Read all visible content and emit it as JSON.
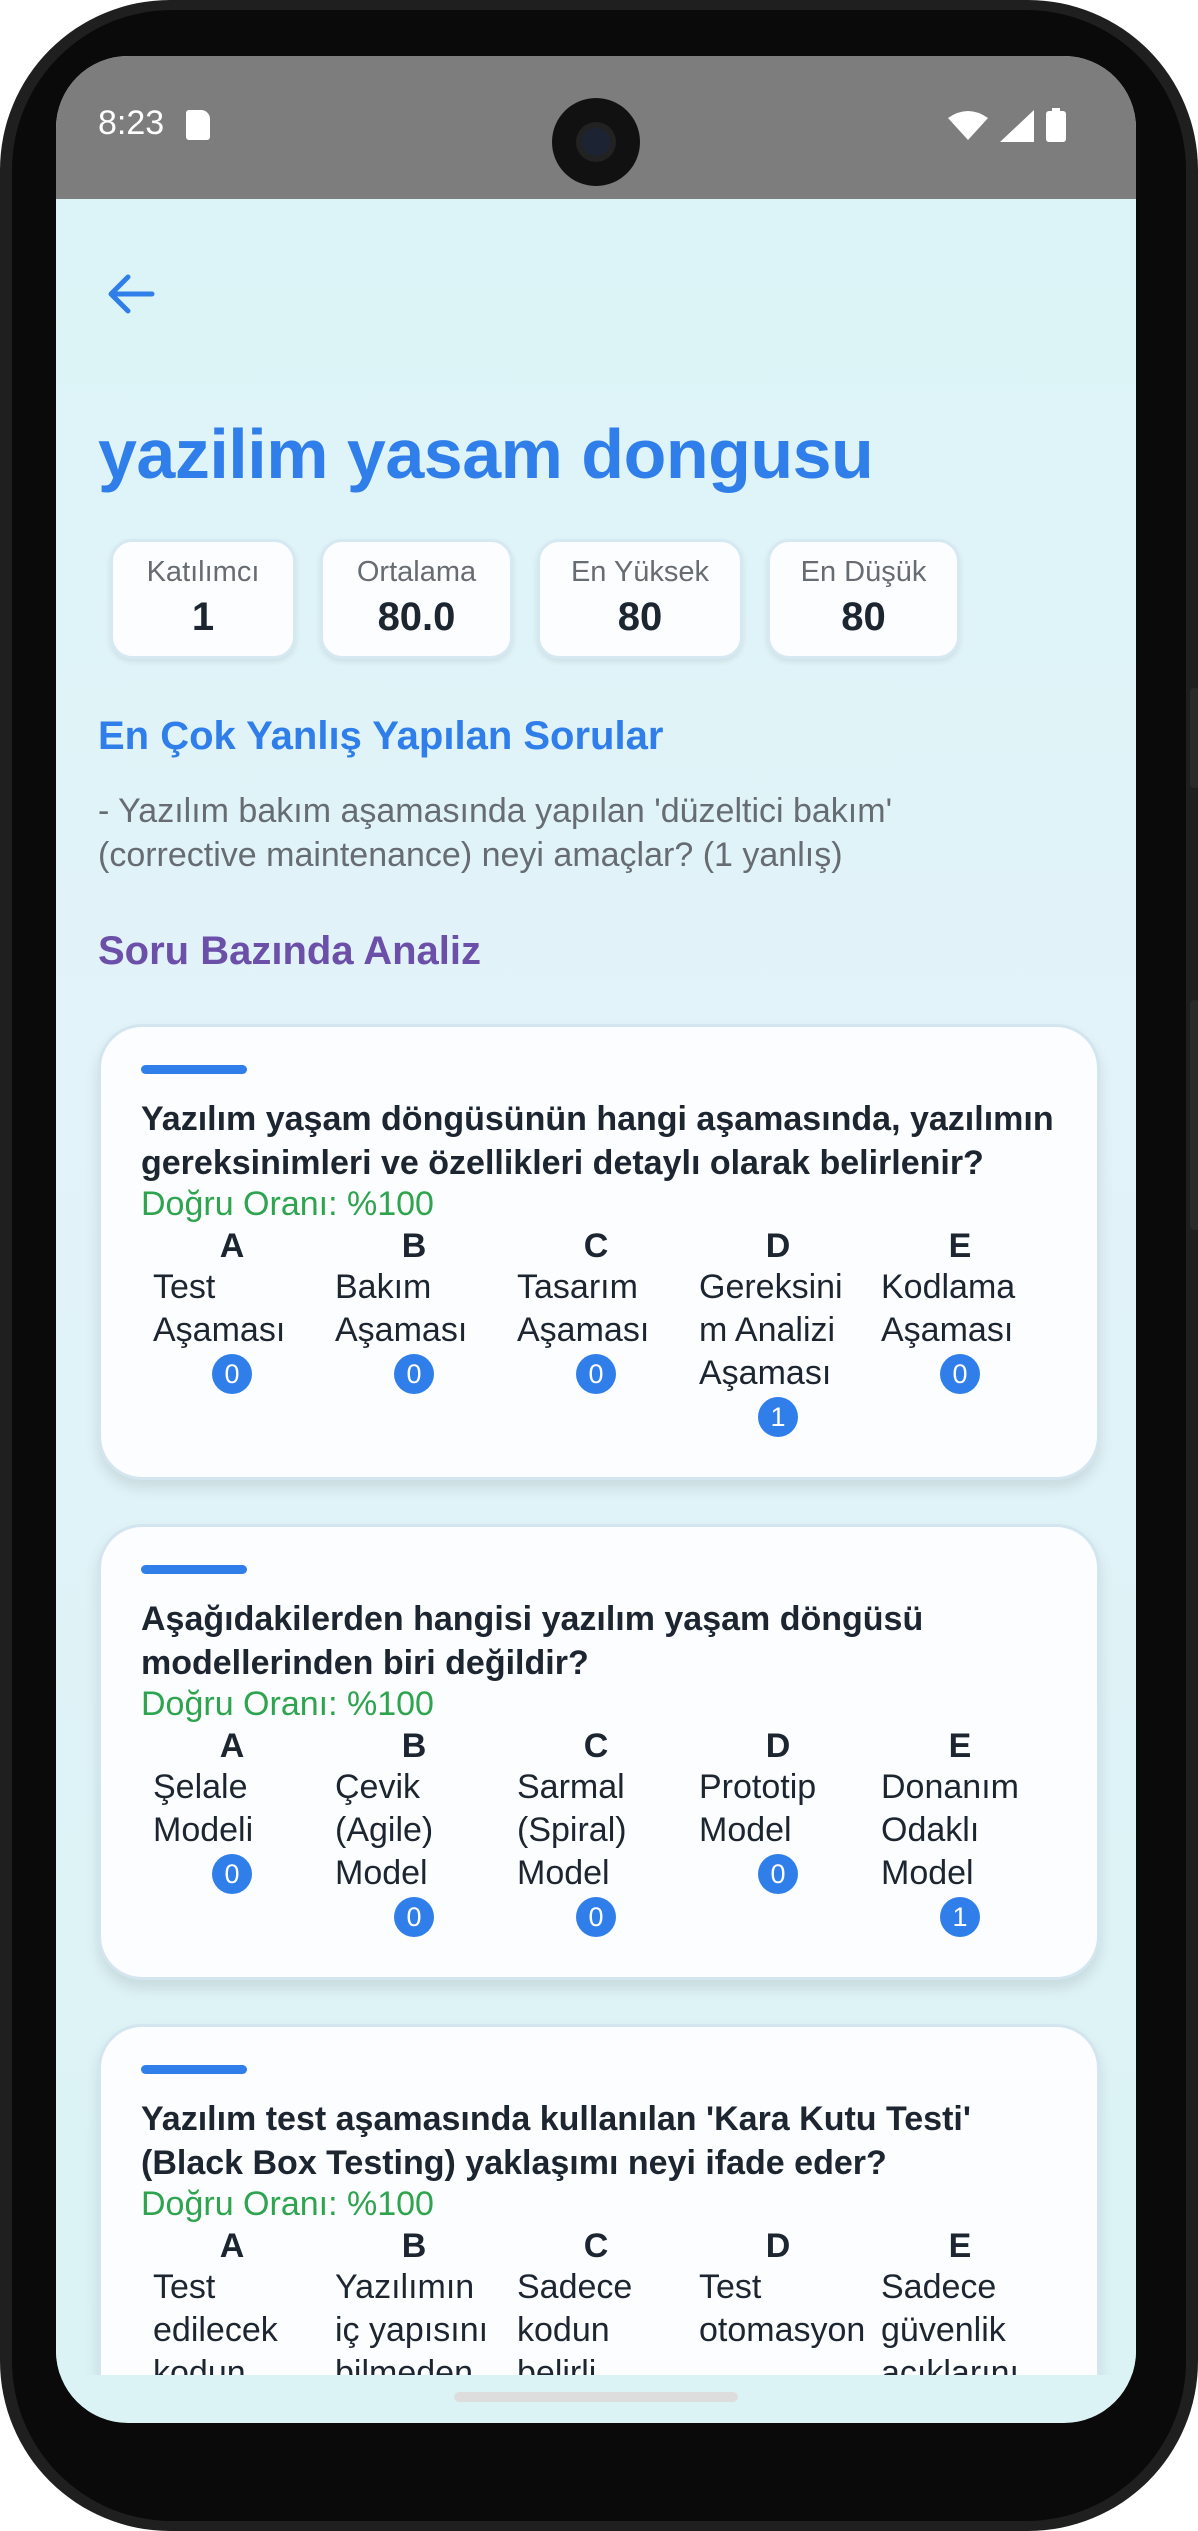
{
  "status_bar": {
    "time": "8:23"
  },
  "page": {
    "title": "yazilim yasam dongusu"
  },
  "stats": [
    {
      "label": "Katılımcı",
      "value": "1"
    },
    {
      "label": "Ortalama",
      "value": "80.0"
    },
    {
      "label": "En Yüksek",
      "value": "80"
    },
    {
      "label": "En Düşük",
      "value": "80"
    }
  ],
  "most_wrong": {
    "heading": "En Çok Yanlış Yapılan Sorular",
    "items": [
      "- Yazılım bakım aşamasında yapılan 'düzeltici bakım' (corrective maintenance) neyi amaçlar? (1 yanlış)"
    ]
  },
  "analysis": {
    "heading": "Soru Bazında Analiz",
    "questions": [
      {
        "text": "Yazılım yaşam döngüsünün hangi aşamasında, yazılımın gereksinimleri ve özellikleri detaylı olarak belirlenir?",
        "rate": "Doğru Oranı: %100",
        "options": [
          {
            "letter": "A",
            "text": "Test Aşaması",
            "count": "0"
          },
          {
            "letter": "B",
            "text": "Bakım Aşaması",
            "count": "0"
          },
          {
            "letter": "C",
            "text": "Tasarım Aşaması",
            "count": "0"
          },
          {
            "letter": "D",
            "text": "Gereksinim Analizi Aşaması",
            "count": "1"
          },
          {
            "letter": "E",
            "text": "Kodlama Aşaması",
            "count": "0"
          }
        ]
      },
      {
        "text": "Aşağıdakilerden hangisi yazılım yaşam döngüsü modellerinden biri değildir?",
        "rate": "Doğru Oranı: %100",
        "options": [
          {
            "letter": "A",
            "text": "Şelale Modeli",
            "count": "0"
          },
          {
            "letter": "B",
            "text": "Çevik (Agile) Model",
            "count": "0"
          },
          {
            "letter": "C",
            "text": "Sarmal (Spiral) Model",
            "count": "0"
          },
          {
            "letter": "D",
            "text": "Prototip Model",
            "count": "0"
          },
          {
            "letter": "E",
            "text": "Donanım Odaklı Model",
            "count": "1"
          }
        ]
      },
      {
        "text": "Yazılım test aşamasında kullanılan 'Kara Kutu Testi' (Black Box Testing) yaklaşımı neyi ifade eder?",
        "rate": "Doğru Oranı: %100",
        "options": [
          {
            "letter": "A",
            "text": "Test edilecek kodun"
          },
          {
            "letter": "B",
            "text": "Yazılımın iç yapısını bilmeden"
          },
          {
            "letter": "C",
            "text": "Sadece kodun belirli"
          },
          {
            "letter": "D",
            "text": "Test otomasyon"
          },
          {
            "letter": "E",
            "text": "Sadece güvenlik açıklarını"
          }
        ]
      }
    ]
  },
  "colors": {
    "accent": "#2f7eea",
    "correct": "#2ea44f",
    "purple": "#6b4fa8",
    "background": "#dcf3f6"
  }
}
